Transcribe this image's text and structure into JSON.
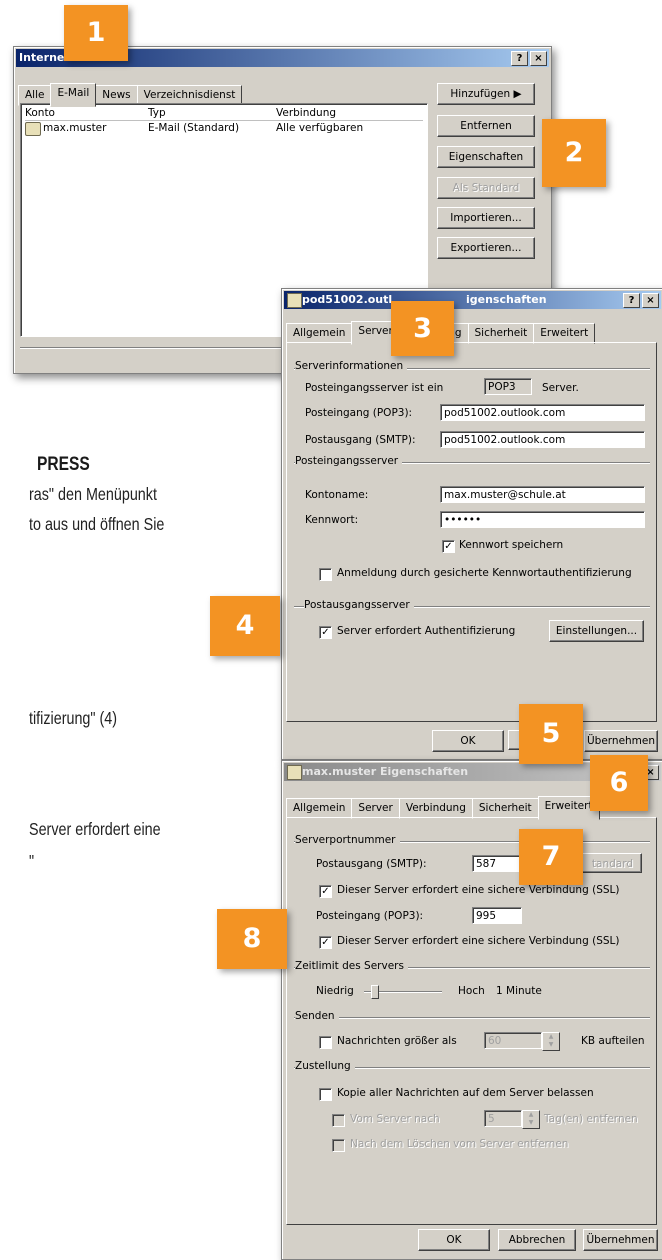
{
  "colors": {
    "badge": "#f39323",
    "titlebar_start": "#0a246a",
    "titlebar_end": "#a6caf0",
    "dialog_face": "#d4d0c8"
  },
  "badges": [
    "1",
    "2",
    "3",
    "4",
    "5",
    "6",
    "7",
    "8"
  ],
  "background_text": {
    "heading": "PRESS",
    "line1": "ras\" den Menüpunkt",
    "line2": "to aus und öffnen Sie",
    "line3": "tifizierung\" (4)",
    "line4": "Server erfordert eine",
    "line5": "\""
  },
  "accounts_dialog": {
    "title": "Internet",
    "title_buttons": [
      "?",
      "×"
    ],
    "tabs": [
      "Alle",
      "E-Mail",
      "News",
      "Verzeichnisdienst"
    ],
    "columns": [
      "Konto",
      "Typ",
      "Verbindung"
    ],
    "rows": [
      {
        "konto": "max.muster",
        "typ": "E-Mail (Standard)",
        "verbindung": "Alle verfügbaren"
      }
    ],
    "buttons": {
      "add": "Hinzufügen",
      "remove": "Entfernen",
      "properties": "Eigenschaften",
      "default": "Als Standard",
      "import": "Importieren...",
      "export": "Exportieren..."
    }
  },
  "server_dialog": {
    "title_left": "pod51002.outl",
    "title_right": "igenschaften",
    "title_buttons": [
      "?",
      "×"
    ],
    "tabs": [
      "Allgemein",
      "Server",
      "g",
      "Sicherheit",
      "Erweitert"
    ],
    "section_info": "Serverinformationen",
    "incoming_type_label": "Posteingangsserver ist ein",
    "incoming_type_value": "POP3",
    "incoming_type_suffix": "Server.",
    "pop3_label": "Posteingang (POP3):",
    "pop3_value": "pod51002.outlook.com",
    "smtp_label": "Postausgang (SMTP):",
    "smtp_value": "pod51002.outlook.com",
    "section_incoming": "Posteingangsserver",
    "account_label": "Kontoname:",
    "account_value": "max.muster@schule.at",
    "password_label": "Kennwort:",
    "password_value": "••••••",
    "save_password": "Kennwort speichern",
    "spa": "Anmeldung durch gesicherte Kennwortauthentifizierung",
    "section_outgoing": "Postausgangsserver",
    "auth_required": "Server erfordert Authentifizierung",
    "settings_button": "Einstellungen...",
    "ok": "OK",
    "cancel": "Ab",
    "apply": "Übernehmen"
  },
  "advanced_dialog": {
    "title": "max.muster Eigenschaften",
    "title_buttons": [
      "×"
    ],
    "tabs": [
      "Allgemein",
      "Server",
      "Verbindung",
      "Sicherheit",
      "Erweitert"
    ],
    "section_ports": "Serverportnummer",
    "smtp_label": "Postausgang (SMTP):",
    "smtp_port": "587",
    "default_button": "tandard",
    "ssl_smtp": "Dieser Server erfordert eine sichere Verbindung (SSL)",
    "pop3_label": "Posteingang (POP3):",
    "pop3_port": "995",
    "ssl_pop3": "Dieser Server erfordert eine sichere Verbindung (SSL)",
    "section_timeout": "Zeitlimit des Servers",
    "timeout_low": "Niedrig",
    "timeout_high": "Hoch",
    "timeout_value": "1 Minute",
    "timeout_level": 0.1,
    "section_send": "Senden",
    "split_label": "Nachrichten größer als",
    "split_value": "60",
    "split_suffix": "KB aufteilen",
    "section_delivery": "Zustellung",
    "leave_copy": "Kopie aller Nachrichten auf dem Server belassen",
    "remove_after_label": "Vom Server nach",
    "remove_after_value": "5",
    "remove_after_suffix": "Tag(en) entfernen",
    "remove_when_deleted": "Nach dem Löschen vom Server entfernen",
    "ok": "OK",
    "cancel": "Abbrechen",
    "apply": "Übernehmen"
  }
}
